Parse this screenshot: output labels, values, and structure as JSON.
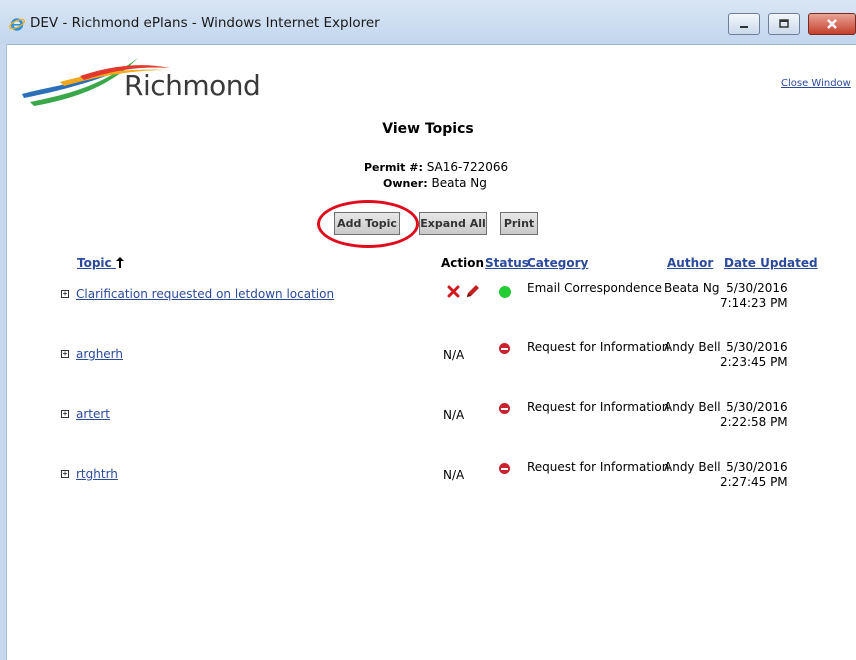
{
  "window": {
    "title": "DEV - Richmond ePlans - Windows Internet Explorer"
  },
  "brand": {
    "logo_text": "Richmond",
    "accent": "#2b4a9c"
  },
  "close_window": "Close Window",
  "heading": "View Topics",
  "permit": {
    "label": "Permit #:",
    "value": "SA16-722066"
  },
  "owner": {
    "label": "Owner:",
    "value": "Beata Ng"
  },
  "buttons": {
    "add_topic": "Add Topic",
    "expand_all": "Expand All",
    "print": "Print"
  },
  "table": {
    "headers": {
      "topic": "Topic",
      "action": "Action",
      "status": "Status",
      "category": "Category",
      "author": "Author",
      "date_updated": "Date Updated"
    },
    "rows": [
      {
        "topic": "Clarification requested on letdown location",
        "action": "edit-delete",
        "status": "open",
        "category": "Email Correspondence",
        "author": "Beata Ng",
        "date": "5/30/2016",
        "time": "7:14:23 PM"
      },
      {
        "topic": "argherh",
        "action": "N/A",
        "status": "closed",
        "category": "Request for Information",
        "author": "Andy Bell",
        "date": "5/30/2016",
        "time": "2:23:45 PM"
      },
      {
        "topic": "artert",
        "action": "N/A",
        "status": "closed",
        "category": "Request for Information",
        "author": "Andy Bell",
        "date": "5/30/2016",
        "time": "2:22:58 PM"
      },
      {
        "topic": "rtghtrh",
        "action": "N/A",
        "status": "closed",
        "category": "Request for Information",
        "author": "Andy Bell",
        "date": "5/30/2016",
        "time": "2:27:45 PM"
      }
    ]
  },
  "status_colors": {
    "open": "#22cc33",
    "closed": "#c8222f"
  },
  "icons": {
    "delete": "x-icon",
    "edit": "pencil-icon",
    "sort": "arrow-up-icon"
  }
}
